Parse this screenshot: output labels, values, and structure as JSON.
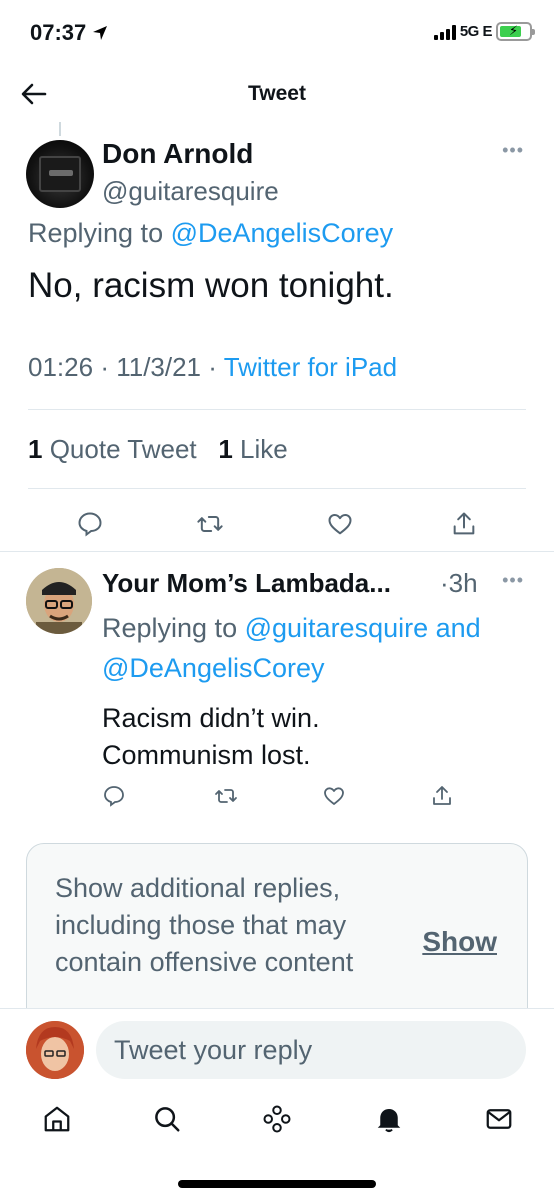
{
  "status_bar": {
    "time": "07:37",
    "network": "5G E",
    "battery_level": 0.75
  },
  "header": {
    "title": "Tweet"
  },
  "main_tweet": {
    "author_name": "Don Arnold",
    "handle": "@guitaresquire",
    "replying_prefix": "Replying to",
    "replying_to": "@DeAngelisCorey",
    "text": "No, racism won tonight.",
    "time": "01:26",
    "date": "11/3/21",
    "source": "Twitter for iPad",
    "quote_count": "1",
    "quote_label": "Quote Tweet",
    "like_count": "1",
    "like_label": "Like"
  },
  "reply_tweet": {
    "author_name": "Your Mom’s Lambada...",
    "time": "·3h",
    "replying_prefix": "Replying to",
    "replying_to_1": "@guitaresquire",
    "and_word": "and",
    "replying_to_2": "@DeAngelisCorey",
    "text_line1": "Racism didn’t win.",
    "text_line2": "Communism lost."
  },
  "offensive_notice": {
    "text": "Show additional replies, including those that may contain offensive content",
    "show_label": "Show"
  },
  "reply_bar": {
    "placeholder": "Tweet your reply"
  },
  "tabs": [
    "home-icon",
    "search-icon",
    "spaces-icon",
    "notifications-icon",
    "messages-icon"
  ],
  "colors": {
    "accent": "#1d9bf0",
    "secondary_text": "#536471",
    "divider": "#e1e8ed"
  }
}
